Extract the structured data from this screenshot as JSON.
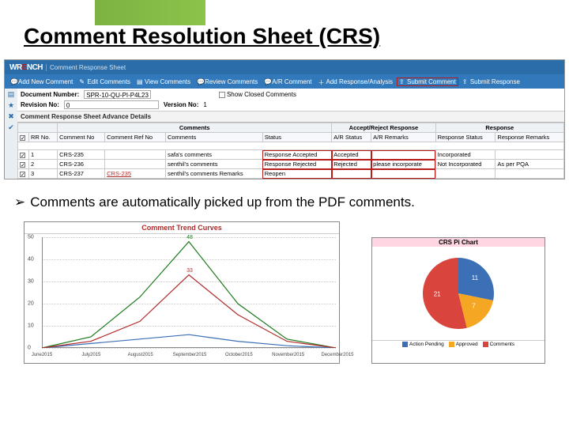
{
  "slide_title": "Comment Resolution Sheet (CRS)",
  "app": {
    "logo": "WRENCH",
    "subtitle": "Comment Response Sheet"
  },
  "toolbar": {
    "add_new": "Add New Comment",
    "edit": "Edit Comments",
    "view": "View Comments",
    "review": "Review Comments",
    "ar_comment": "A/R Comment",
    "add_response": "Add Response/Analysis",
    "submit_comment": "Submit Comment",
    "submit_response": "Submit Response"
  },
  "docinfo": {
    "doc_num_label": "Document Number:",
    "doc_num": "SPR-10-QU-PI-P4L23",
    "show_closed_label": "Show Closed Comments",
    "revision_label": "Revision No:",
    "revision": "0",
    "version_label": "Version No:",
    "version": "1"
  },
  "section_title": "Comment Response Sheet Advance Details",
  "table": {
    "groups": {
      "blank": "",
      "comments": "Comments",
      "ar": "Accept/Reject Response",
      "resp": "Response"
    },
    "cols": {
      "chk": "",
      "rrno": "RR No.",
      "cno": "Comment No",
      "crefno": "Comment Ref No",
      "comments": "Comments",
      "status": "Status",
      "arstatus": "A/R Status",
      "arremarks": "A/R Remarks",
      "rstatus": "Response Status",
      "rremarks": "Response Remarks"
    },
    "rows": [
      {
        "rr": "1",
        "cno": "CRS-235",
        "cref": "",
        "com": "safa's comments",
        "status": "Response Accepted",
        "ar": "Accepted",
        "arrem": "",
        "rs": "Incorporated",
        "rrem": ""
      },
      {
        "rr": "2",
        "cno": "CRS-236",
        "cref": "",
        "com": "senthil's comments",
        "status": "Response Rejected",
        "ar": "Rejected",
        "arrem": "please incorporate",
        "rs": "Not Incorporated",
        "rrem": "As per PQA"
      },
      {
        "rr": "3",
        "cno": "CRS-237",
        "cref": "CRS-235",
        "com": "senthil's comments Remarks",
        "status": "Reopen",
        "ar": "",
        "arrem": "",
        "rs": "",
        "rrem": ""
      }
    ]
  },
  "bullet_text": "Comments are automatically picked up from the PDF comments.",
  "chart_data": [
    {
      "type": "line",
      "title": "Comment Trend Curves",
      "xlabel": "",
      "ylabel": "",
      "ylim": [
        0,
        50
      ],
      "yticks": [
        0,
        10,
        20,
        30,
        40,
        50
      ],
      "categories": [
        "June 2015",
        "July 2015",
        "August 2015",
        "September 2015",
        "October 2015",
        "November 2015",
        "December 2015"
      ],
      "series": [
        {
          "name": "Approved",
          "color": "#3b6fb6",
          "values": [
            0,
            2,
            4,
            6,
            3,
            1,
            0
          ]
        },
        {
          "name": "Action Pending",
          "color": "#1b7a1b",
          "values": [
            0,
            5,
            23,
            48,
            20,
            4,
            0
          ]
        },
        {
          "name": "Comments",
          "color": "#b02a2a",
          "values": [
            0,
            3,
            12,
            33,
            15,
            3,
            0
          ]
        }
      ],
      "peak_labels": [
        {
          "x": "September 2015",
          "value": 48,
          "color": "#1b7a1b"
        },
        {
          "x": "September 2015",
          "value": 33,
          "color": "#b02a2a"
        }
      ]
    },
    {
      "type": "pie",
      "title": "CRS Pi Chart",
      "series": [
        {
          "name": "Action Pending",
          "color": "#3b6fb6",
          "value": 11
        },
        {
          "name": "Approved",
          "color": "#f5a623",
          "value": 7
        },
        {
          "name": "Comments",
          "color": "#d9453d",
          "value": 21
        }
      ]
    }
  ]
}
